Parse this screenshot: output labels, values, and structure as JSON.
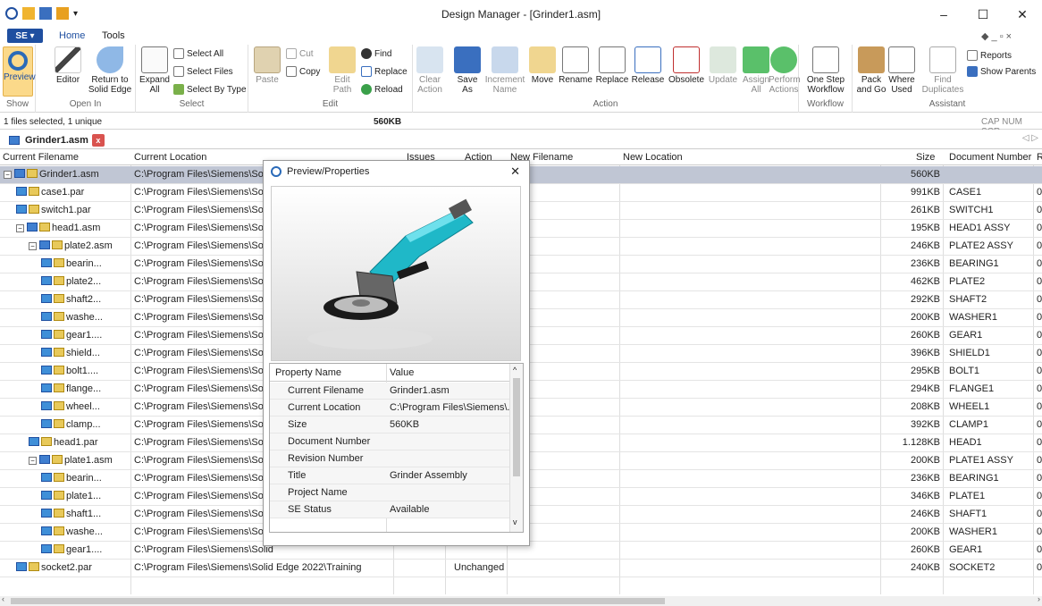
{
  "window": {
    "title": "Design Manager - [Grinder1.asm]",
    "minimize": "–",
    "maximize": "☐",
    "close": "✕"
  },
  "menu": {
    "app_button": "SE ▾",
    "tabs": [
      "Home",
      "Tools"
    ],
    "right_icons": "◆ _ ▫ ×"
  },
  "ribbon": {
    "show": {
      "preview": "Preview",
      "group": "Show"
    },
    "open_in": {
      "editor": "Editor",
      "return_to": "Return to Solid Edge",
      "group": "Open In"
    },
    "select": {
      "expand_all": "Expand All",
      "select_all": "Select All",
      "select_files": "Select Files",
      "select_by_type": "Select By Type",
      "group": "Select"
    },
    "edit": {
      "paste": "Paste",
      "cut": "Cut",
      "copy": "Copy",
      "edit_path": "Edit Path",
      "find": "Find",
      "replace": "Replace",
      "reload": "Reload",
      "group": "Edit"
    },
    "action": {
      "clear_action": "Clear Action",
      "save_as": "Save As",
      "increment_name": "Increment Name",
      "move": "Move",
      "rename": "Rename",
      "replace": "Replace",
      "release": "Release",
      "obsolete": "Obsolete",
      "update": "Update",
      "assign_all": "Assign All",
      "perform_actions": "Perform Actions",
      "group": "Action"
    },
    "workflow": {
      "one_step": "One Step Workflow",
      "group": "Workflow"
    },
    "assistant": {
      "pack_and_go": "Pack and Go",
      "where_used": "Where Used",
      "find_duplicates": "Find Duplicates",
      "reports": "Reports",
      "show_parents": "Show Parents",
      "group": "Assistant"
    }
  },
  "status": {
    "left": "1 files selected, 1 unique",
    "size": "560KB",
    "indicators": "CAP NUM SCR"
  },
  "doc_tab": {
    "label": "Grinder1.asm",
    "close": "x",
    "nav": "◁ ▷"
  },
  "columns": {
    "current_filename": "Current Filename",
    "current_location": "Current Location",
    "issues": "Issues",
    "action": "Action",
    "new_filename": "New Filename",
    "new_location": "New Location",
    "size": "Size",
    "document_number": "Document Number",
    "extra": "R"
  },
  "rows": [
    {
      "name": "Grinder1.asm",
      "loc": "C:\\Program Files\\Siemens\\Solid",
      "action": "",
      "size": "560KB",
      "doc": "",
      "extra": ""
    },
    {
      "name": "case1.par",
      "loc": "C:\\Program Files\\Siemens\\Solid",
      "action": "",
      "size": "991KB",
      "doc": "CASE1",
      "extra": "0"
    },
    {
      "name": "switch1.par",
      "loc": "C:\\Program Files\\Siemens\\Solid",
      "action": "",
      "size": "261KB",
      "doc": "SWITCH1",
      "extra": "0"
    },
    {
      "name": "head1.asm",
      "loc": "C:\\Program Files\\Siemens\\Solid",
      "action": "",
      "size": "195KB",
      "doc": "HEAD1 ASSY",
      "extra": "0"
    },
    {
      "name": "plate2.asm",
      "loc": "C:\\Program Files\\Siemens\\Solid",
      "action": "",
      "size": "246KB",
      "doc": "PLATE2 ASSY",
      "extra": "0"
    },
    {
      "name": "bearin...",
      "loc": "C:\\Program Files\\Siemens\\Solid",
      "action": "",
      "size": "236KB",
      "doc": "BEARING1",
      "extra": "0"
    },
    {
      "name": "plate2...",
      "loc": "C:\\Program Files\\Siemens\\Solid",
      "action": "",
      "size": "462KB",
      "doc": "PLATE2",
      "extra": "0"
    },
    {
      "name": "shaft2...",
      "loc": "C:\\Program Files\\Siemens\\Solid",
      "action": "",
      "size": "292KB",
      "doc": "SHAFT2",
      "extra": "0"
    },
    {
      "name": "washe...",
      "loc": "C:\\Program Files\\Siemens\\Solid",
      "action": "",
      "size": "200KB",
      "doc": "WASHER1",
      "extra": "0"
    },
    {
      "name": "gear1....",
      "loc": "C:\\Program Files\\Siemens\\Solid",
      "action": "",
      "size": "260KB",
      "doc": "GEAR1",
      "extra": "0"
    },
    {
      "name": "shield...",
      "loc": "C:\\Program Files\\Siemens\\Solid",
      "action": "",
      "size": "396KB",
      "doc": "SHIELD1",
      "extra": "0"
    },
    {
      "name": "bolt1....",
      "loc": "C:\\Program Files\\Siemens\\Solid",
      "action": "",
      "size": "295KB",
      "doc": "BOLT1",
      "extra": "0"
    },
    {
      "name": "flange...",
      "loc": "C:\\Program Files\\Siemens\\Solid",
      "action": "",
      "size": "294KB",
      "doc": "FLANGE1",
      "extra": "0"
    },
    {
      "name": "wheel...",
      "loc": "C:\\Program Files\\Siemens\\Solid",
      "action": "",
      "size": "208KB",
      "doc": "WHEEL1",
      "extra": "0"
    },
    {
      "name": "clamp...",
      "loc": "C:\\Program Files\\Siemens\\Solid",
      "action": "",
      "size": "392KB",
      "doc": "CLAMP1",
      "extra": "0"
    },
    {
      "name": "head1.par",
      "loc": "C:\\Program Files\\Siemens\\Solid",
      "action": "",
      "size": "1.128KB",
      "doc": "HEAD1",
      "extra": "0"
    },
    {
      "name": "plate1.asm",
      "loc": "C:\\Program Files\\Siemens\\Solid",
      "action": "",
      "size": "200KB",
      "doc": "PLATE1 ASSY",
      "extra": "0"
    },
    {
      "name": "bearin...",
      "loc": "C:\\Program Files\\Siemens\\Solid",
      "action": "",
      "size": "236KB",
      "doc": "BEARING1",
      "extra": "0"
    },
    {
      "name": "plate1...",
      "loc": "C:\\Program Files\\Siemens\\Solid",
      "action": "",
      "size": "346KB",
      "doc": "PLATE1",
      "extra": "0"
    },
    {
      "name": "shaft1...",
      "loc": "C:\\Program Files\\Siemens\\Solid",
      "action": "",
      "size": "246KB",
      "doc": "SHAFT1",
      "extra": "0"
    },
    {
      "name": "washe...",
      "loc": "C:\\Program Files\\Siemens\\Solid",
      "action": "",
      "size": "200KB",
      "doc": "WASHER1",
      "extra": "0"
    },
    {
      "name": "gear1....",
      "loc": "C:\\Program Files\\Siemens\\Solid",
      "action": "",
      "size": "260KB",
      "doc": "GEAR1",
      "extra": "0"
    },
    {
      "name": "socket2.par",
      "loc": "C:\\Program Files\\Siemens\\Solid Edge 2022\\Training",
      "action": "Unchanged",
      "size": "240KB",
      "doc": "SOCKET2",
      "extra": "0"
    }
  ],
  "dialog": {
    "title": "Preview/Properties",
    "close": "✕",
    "prop_header": "Property Name",
    "value_header": "Value",
    "properties": [
      {
        "name": "Current Filename",
        "value": "Grinder1.asm"
      },
      {
        "name": "Current Location",
        "value": "C:\\Program Files\\Siemens\\..."
      },
      {
        "name": "Size",
        "value": "560KB"
      },
      {
        "name": "Document Number",
        "value": ""
      },
      {
        "name": "Revision Number",
        "value": ""
      },
      {
        "name": "Title",
        "value": "Grinder Assembly"
      },
      {
        "name": "Project Name",
        "value": ""
      },
      {
        "name": "SE Status",
        "value": "Available"
      }
    ]
  },
  "colors": {
    "accent": "#1f4fa0",
    "selected_row": "#c0c6d4",
    "tool_teal": "#1fb8c8"
  }
}
